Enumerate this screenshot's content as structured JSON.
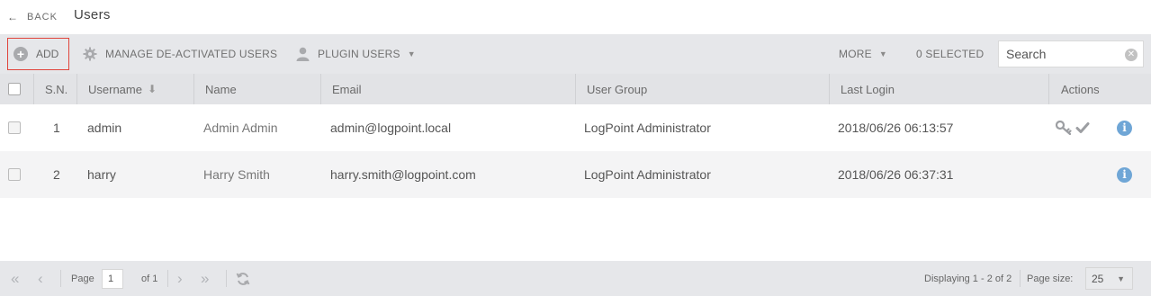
{
  "header": {
    "back_label": "BACK",
    "title": "Users"
  },
  "toolbar": {
    "add_label": "ADD",
    "manage_label": "MANAGE DE-ACTIVATED USERS",
    "plugin_label": "PLUGIN USERS",
    "more_label": "MORE",
    "selected_label": "0 SELECTED",
    "search_placeholder": "Search"
  },
  "table": {
    "columns": [
      "S.N.",
      "Username",
      "Name",
      "Email",
      "User Group",
      "Last Login",
      "Actions"
    ],
    "rows": [
      {
        "sn": "1",
        "username": "admin",
        "name": "Admin Admin",
        "email": "admin@logpoint.local",
        "group": "LogPoint Administrator",
        "last_login": "2018/06/26 06:13:57",
        "actions": [
          "key-icon",
          "check-icon",
          "info-icon"
        ]
      },
      {
        "sn": "2",
        "username": "harry",
        "name": "Harry Smith",
        "email": "harry.smith@logpoint.com",
        "group": "LogPoint Administrator",
        "last_login": "2018/06/26 06:37:31",
        "actions": [
          "info-icon"
        ]
      }
    ]
  },
  "footer": {
    "page_label": "Page",
    "page_value": "1",
    "of_label": "of 1",
    "displaying": "Displaying 1 - 2 of 2",
    "page_size_label": "Page size:",
    "page_size_value": "25"
  },
  "colors": {
    "toolbar_bg": "#e6e7ea",
    "header_row_bg": "#e2e3e6",
    "alt_row_bg": "#f4f4f5",
    "highlight_border": "#e0443b",
    "info_icon": "#6fa6d6"
  }
}
